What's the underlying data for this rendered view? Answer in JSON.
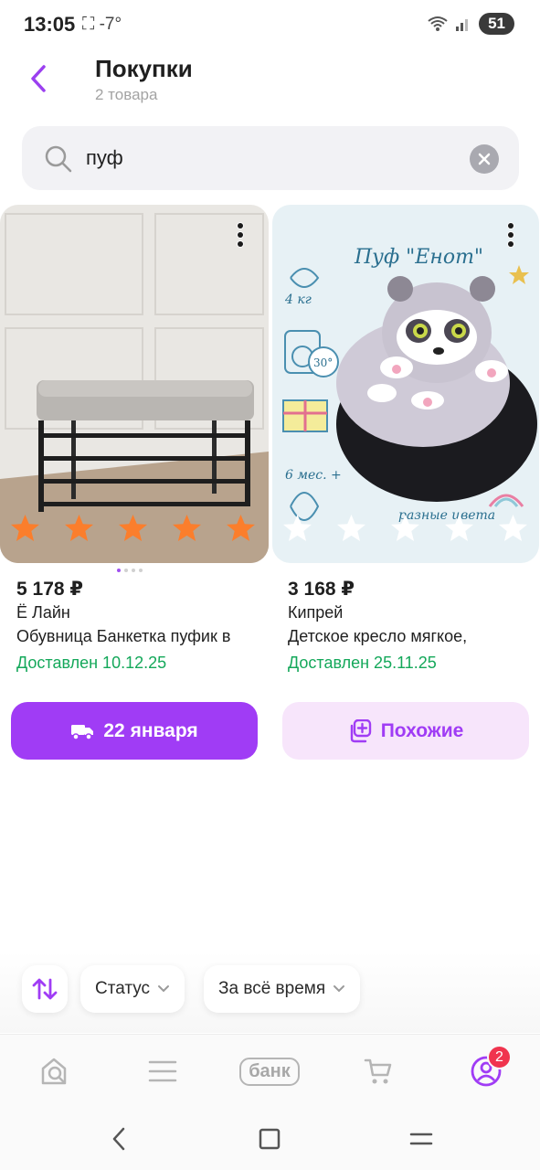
{
  "status_bar": {
    "time": "13:05",
    "left_icons": "⛶ -7°",
    "battery": "51"
  },
  "header": {
    "title": "Покупки",
    "subtitle": "2 товара"
  },
  "search": {
    "value": "пуф",
    "placeholder": ""
  },
  "products": [
    {
      "price": "5 178 ₽",
      "brand": "Ё Лайн",
      "name": "Обувница Банкетка пуфик в",
      "status": "Доставлен 10.12.25",
      "rating_filled": 5,
      "star_color": "#fb7e2c",
      "image_caption": ""
    },
    {
      "price": "3 168 ₽",
      "brand": "Кипрей",
      "name": "Детское кресло мягкое,",
      "status": "Доставлен 25.11.25",
      "rating_filled": 0,
      "star_color": "#ffffff",
      "image_caption": "Пуф \"Енот\""
    }
  ],
  "image_dots": {
    "count": 4,
    "active": 0
  },
  "actions": {
    "delivery_label": "22 января",
    "similar_label": "Похожие"
  },
  "filters": {
    "status_label": "Статус",
    "period_label": "За всё время"
  },
  "bottom_nav": {
    "bank_label": "банк",
    "profile_badge": "2"
  },
  "colors": {
    "accent": "#a03cf5",
    "accent_light": "#f7e5fb",
    "delivered_green": "#14a85a",
    "badge_red": "#f0344e"
  }
}
